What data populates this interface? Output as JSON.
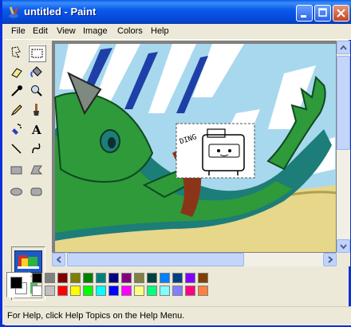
{
  "window": {
    "title": "untitled - Paint",
    "colors": {
      "title_gradient": "#0a5bed",
      "frame": "#0831d9",
      "face": "#ece9d8"
    }
  },
  "menu": {
    "items": [
      {
        "label": "File"
      },
      {
        "label": "Edit"
      },
      {
        "label": "View"
      },
      {
        "label": "Image"
      },
      {
        "label": "Colors"
      },
      {
        "label": "Help"
      }
    ]
  },
  "tools": [
    "free-form-select-icon",
    "select-icon",
    "eraser-icon",
    "fill-icon",
    "pick-color-icon",
    "magnifier-icon",
    "pencil-icon",
    "brush-icon",
    "airbrush-icon",
    "text-icon",
    "line-icon",
    "curve-icon",
    "rectangle-icon",
    "polygon-icon",
    "ellipse-icon",
    "rounded-rectangle-icon"
  ],
  "canvas": {
    "speech_text": "DING",
    "colors": {
      "sky": "#a8d8ee",
      "dragon": "#2e9a3a",
      "dragon_dark": "#1b6a35",
      "teal": "#1d7d78",
      "hair": "#8b3518",
      "tail": "#e6d78a"
    }
  },
  "palette": {
    "foreground": "#000000",
    "background": "#ffffff",
    "row1": [
      "#000000",
      "#808080",
      "#800000",
      "#808000",
      "#008000",
      "#008080",
      "#000080",
      "#800080",
      "#808040",
      "#004040",
      "#0080ff",
      "#004080",
      "#8000ff",
      "#804000"
    ],
    "row2": [
      "#ffffff",
      "#c0c0c0",
      "#ff0000",
      "#ffff00",
      "#00ff00",
      "#00ffff",
      "#0000ff",
      "#ff00ff",
      "#ffff80",
      "#00ff80",
      "#80ffff",
      "#8080ff",
      "#ff0080",
      "#ff8040"
    ]
  },
  "status": {
    "text": "For Help, click Help Topics on the Help Menu."
  }
}
